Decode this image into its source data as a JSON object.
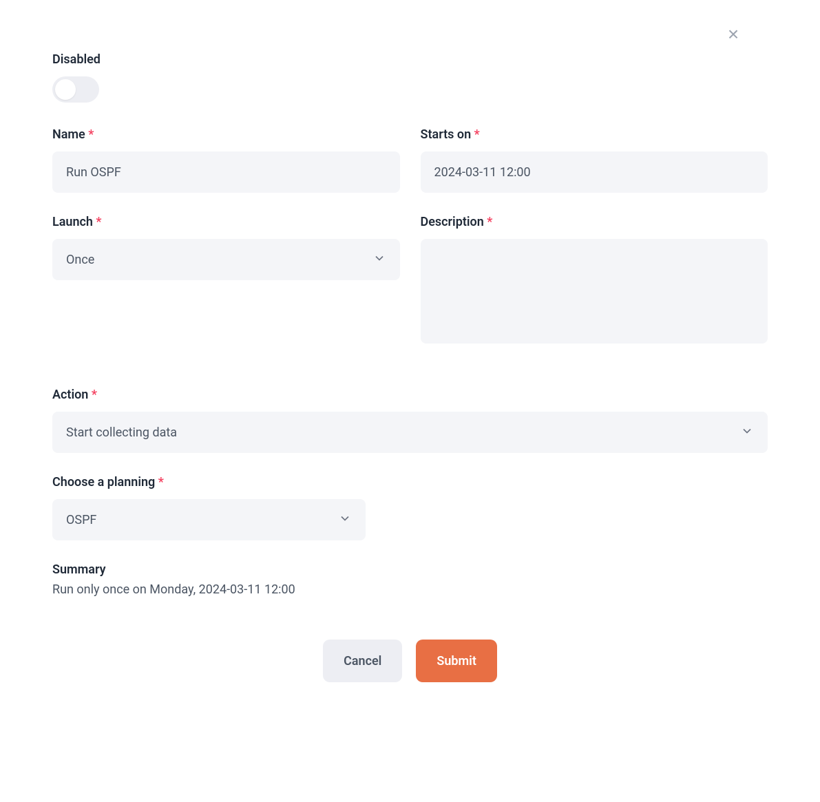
{
  "labels": {
    "disabled": "Disabled",
    "name": "Name",
    "starts_on": "Starts on",
    "launch": "Launch",
    "description": "Description",
    "action": "Action",
    "planning": "Choose a planning",
    "summary": "Summary"
  },
  "required_marker": "*",
  "values": {
    "disabled": false,
    "name": "Run OSPF",
    "starts_on": "2024-03-11 12:00",
    "launch": "Once",
    "description": "",
    "action": "Start collecting data",
    "planning": "OSPF"
  },
  "summary_text": "Run only once on Monday, 2024-03-11 12:00",
  "buttons": {
    "cancel": "Cancel",
    "submit": "Submit"
  }
}
